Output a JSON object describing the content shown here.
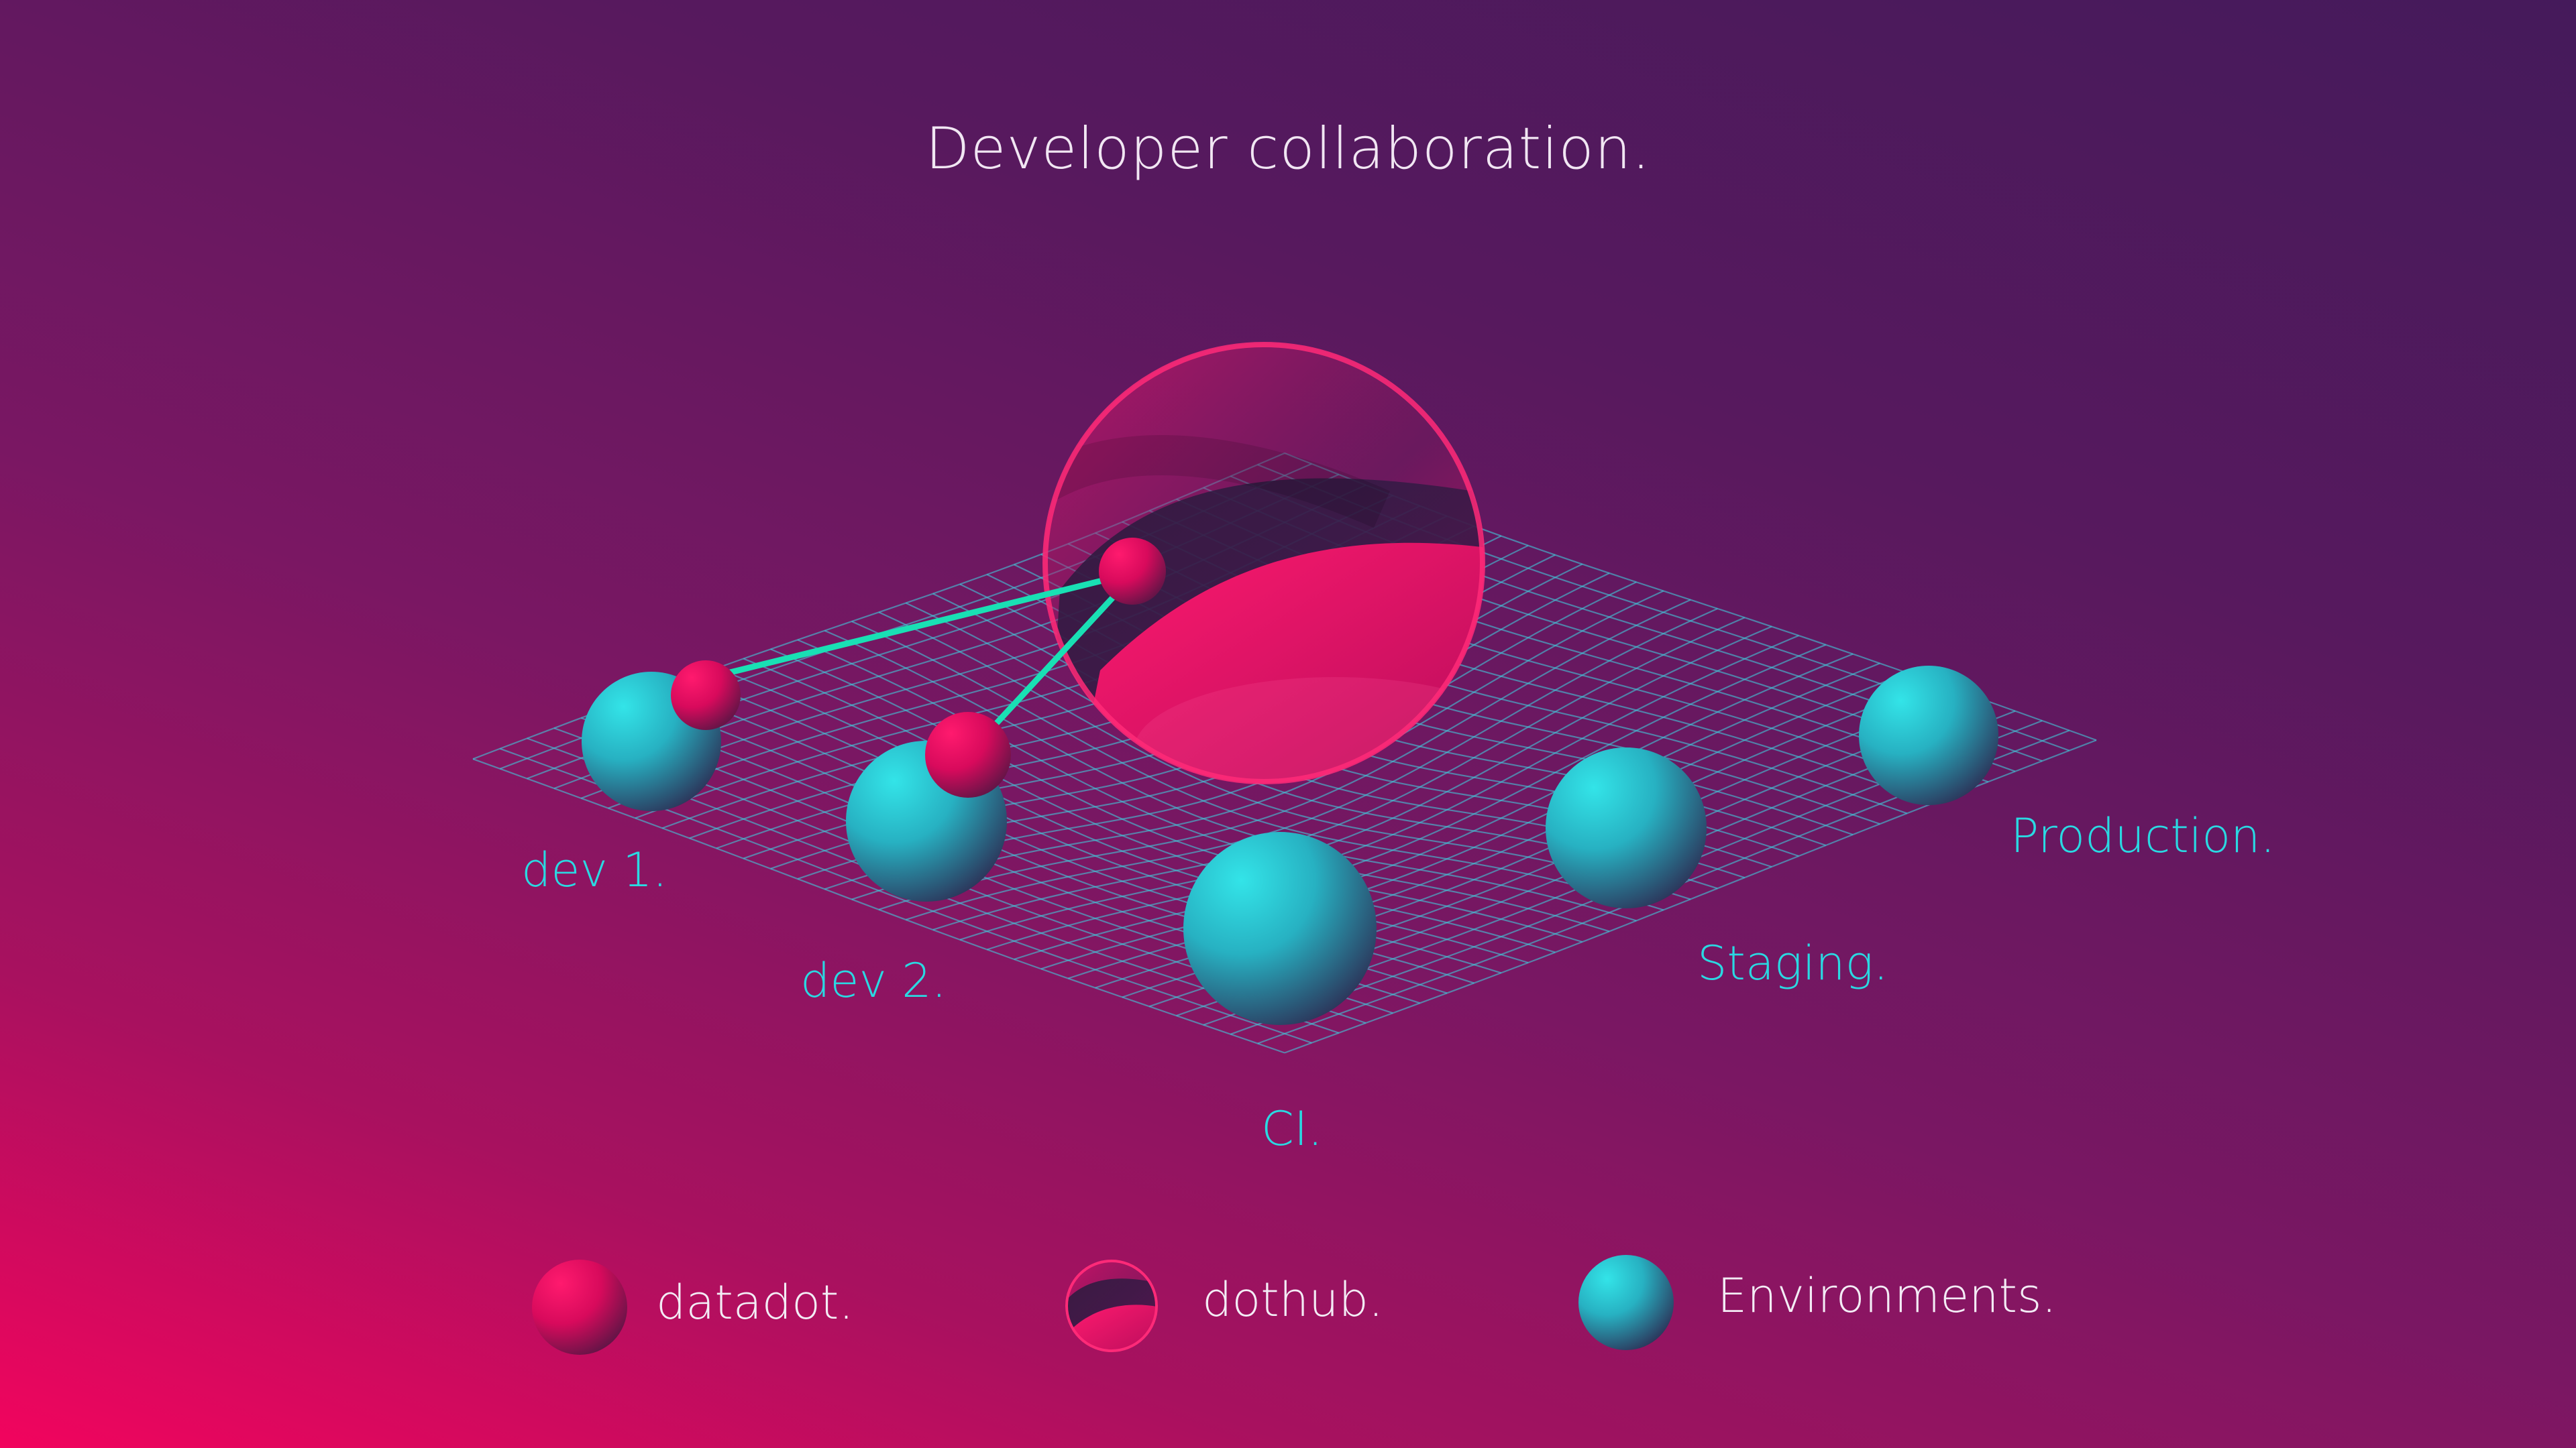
{
  "title": "Developer collaboration.",
  "environments": [
    {
      "id": "dev1",
      "label": "dev 1."
    },
    {
      "id": "dev2",
      "label": "dev 2."
    },
    {
      "id": "ci",
      "label": "CI."
    },
    {
      "id": "staging",
      "label": "Staging."
    },
    {
      "id": "production",
      "label": "Production."
    }
  ],
  "legend": [
    {
      "label": "datadot.",
      "icon": "datadot-sphere-icon"
    },
    {
      "label": "dothub.",
      "icon": "dothub-sphere-icon"
    },
    {
      "label": "Environments.",
      "icon": "environment-sphere-icon"
    }
  ],
  "colors": {
    "background_top": "#451a5b",
    "background_bottom": "#f2045e",
    "environment": "#2ad9e2",
    "datadot": "#f2045e",
    "connection": "#19e0b4",
    "grid": "#43c6d9"
  }
}
